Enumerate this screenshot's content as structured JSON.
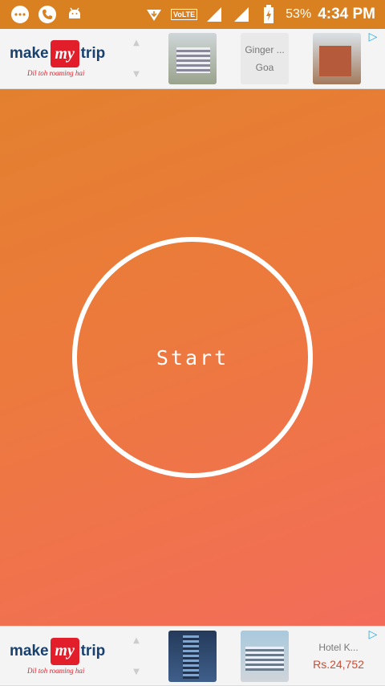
{
  "status_bar": {
    "icons_left": [
      "message-icon",
      "phone-icon",
      "android-icon"
    ],
    "icons_right": [
      "download-icon",
      "volte-icon",
      "signal-icon",
      "signal-icon",
      "battery-icon"
    ],
    "volte_label": "VoLTE",
    "battery": "53%",
    "time": "4:34 PM"
  },
  "ad_top": {
    "brand_make": "make",
    "brand_my": "my",
    "brand_trip": "trip",
    "tagline": "Dil toh roaming hai",
    "card_title": "Ginger ...",
    "card_subtitle": "Goa"
  },
  "main": {
    "start_label": "Start"
  },
  "ad_bottom": {
    "brand_make": "make",
    "brand_my": "my",
    "brand_trip": "trip",
    "tagline": "Dil toh roaming hai",
    "card_title": "Hotel K...",
    "card_price": "Rs.24,752"
  },
  "colors": {
    "status_bar_bg": "#d98020",
    "gradient_top": "#e0822a",
    "gradient_bottom": "#f46a5e",
    "brand_blue": "#19416f",
    "brand_red": "#e21e2b"
  }
}
